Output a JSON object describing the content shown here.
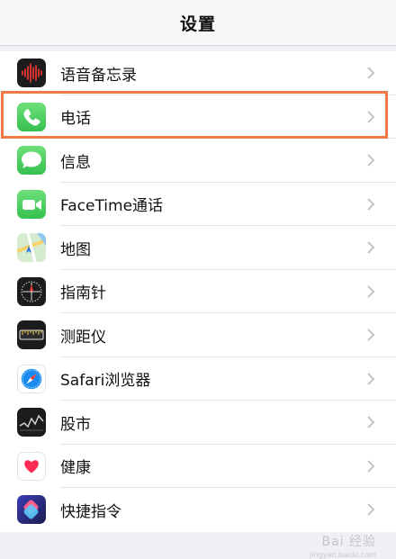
{
  "nav": {
    "title": "设置"
  },
  "rows": [
    {
      "label": "语音备忘录",
      "icon": "voice-memos-icon",
      "color": "#1c1c1e"
    },
    {
      "label": "电话",
      "icon": "phone-icon",
      "color": "#4cd964"
    },
    {
      "label": "信息",
      "icon": "messages-icon",
      "color": "#4cd964"
    },
    {
      "label": "FaceTime通话",
      "icon": "facetime-icon",
      "color": "#4cd964"
    },
    {
      "label": "地图",
      "icon": "maps-icon",
      "color": "#8fd3a0"
    },
    {
      "label": "指南针",
      "icon": "compass-icon",
      "color": "#1c1c1e"
    },
    {
      "label": "测距仪",
      "icon": "measure-icon",
      "color": "#1c1c1e"
    },
    {
      "label": "Safari浏览器",
      "icon": "safari-icon",
      "color": "#ffffff"
    },
    {
      "label": "股市",
      "icon": "stocks-icon",
      "color": "#1c1c1e"
    },
    {
      "label": "健康",
      "icon": "health-icon",
      "color": "#ffffff"
    },
    {
      "label": "快捷指令",
      "icon": "shortcuts-icon",
      "color": "#3a3fb5"
    }
  ],
  "highlight_color": "#ef7a45",
  "watermark": {
    "main": "Bai 经验",
    "sub": "jingyan.baidu.com"
  }
}
